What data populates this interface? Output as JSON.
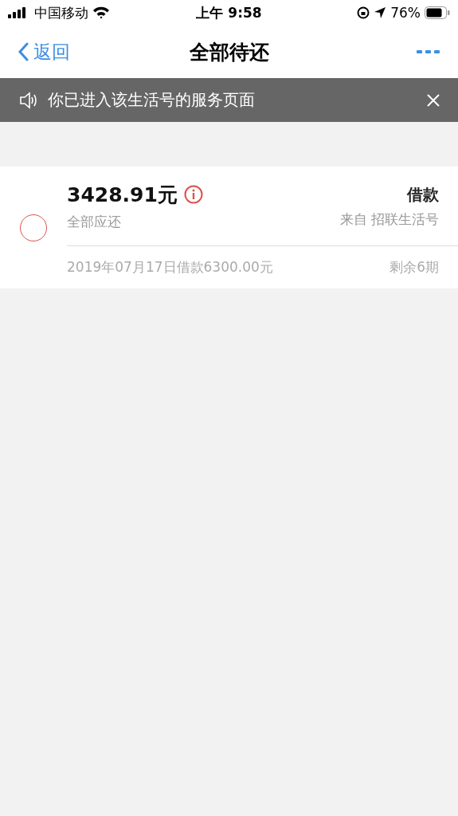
{
  "status_bar": {
    "carrier": "中国移动",
    "time": "上午 9:58",
    "battery": "76%"
  },
  "nav": {
    "back": "返回",
    "title": "全部待还"
  },
  "notice": {
    "text": "你已进入该生活号的服务页面"
  },
  "loans": [
    {
      "selected": false,
      "amount": "3428.91元",
      "amount_label": "全部应还",
      "type": "借款",
      "source": "来自 招联生活号",
      "detail": "2019年07月17日借款6300.00元",
      "remaining": "剩余6期"
    }
  ]
}
